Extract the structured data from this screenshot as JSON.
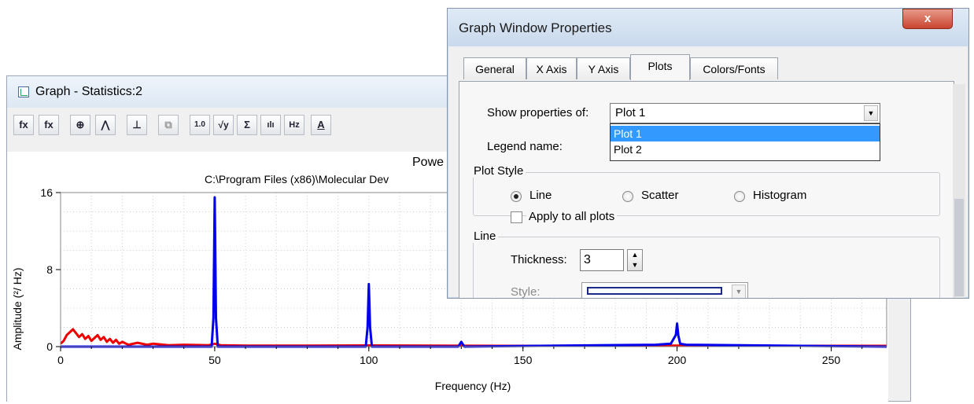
{
  "graph_window": {
    "title": "Graph - Statistics:2",
    "toolbar": [
      {
        "icon": "fx-icon",
        "label": "fx"
      },
      {
        "icon": "formula-sheet-icon",
        "label": "fx"
      },
      {
        "icon": "zoom-in-icon",
        "label": "⊕"
      },
      {
        "icon": "autoscale-icon",
        "label": "⋀"
      },
      {
        "icon": "axis-icon",
        "label": "⊥"
      },
      {
        "icon": "copy-icon",
        "label": "⧉"
      },
      {
        "icon": "scale-1-0-icon",
        "label": "1.0"
      },
      {
        "icon": "sqrt-y-icon",
        "label": "√y"
      },
      {
        "icon": "sigma-icon",
        "label": "Σ"
      },
      {
        "icon": "histogram-icon",
        "label": "ılı"
      },
      {
        "icon": "hz-icon",
        "label": "Hz"
      },
      {
        "icon": "text-icon",
        "label": "A"
      }
    ],
    "plot_title": "Powe",
    "plot_subtitle": "C:\\Program Files (x86)\\Molecular Dev"
  },
  "chart_data": {
    "type": "line",
    "title": "Powe",
    "subtitle": "C:\\Program Files (x86)\\Molecular Dev",
    "xlabel": "Frequency (Hz)",
    "ylabel": "Amplitude (²/ Hz)",
    "xlim": [
      0,
      268
    ],
    "ylim": [
      0,
      16
    ],
    "xticks": [
      "0",
      "50",
      "100",
      "150",
      "200",
      "250"
    ],
    "yticks": [
      "0",
      "8",
      "16"
    ],
    "grid": true,
    "series": [
      {
        "color": "#0000ee",
        "x": [
          0,
          49,
          49.6,
          50,
          50.4,
          51,
          99,
          99.6,
          100,
          100.4,
          101,
          129,
          130,
          131,
          193,
          198,
          199.6,
          200,
          200.4,
          201,
          203,
          268
        ],
        "y": [
          0,
          0,
          3,
          15.5,
          3,
          0,
          0,
          2,
          6.5,
          2,
          0,
          0,
          0.5,
          0,
          0.2,
          0.3,
          1.2,
          2.4,
          1.2,
          0.3,
          0.2,
          0
        ]
      },
      {
        "color": "#ee0000",
        "x": [
          0,
          1,
          2,
          3,
          4,
          5,
          6,
          7,
          8,
          9,
          10,
          11,
          12,
          13,
          14,
          15,
          16,
          17,
          18,
          19,
          20,
          22,
          25,
          28,
          30,
          35,
          40,
          48,
          50,
          52,
          60,
          80,
          100,
          120,
          150,
          180,
          200,
          220,
          250,
          268
        ],
        "y": [
          0.3,
          0.6,
          1.2,
          1.5,
          1.8,
          1.4,
          1.0,
          1.3,
          0.8,
          1.1,
          0.6,
          0.9,
          1.2,
          0.7,
          1.0,
          0.5,
          0.8,
          0.4,
          0.7,
          0.3,
          0.5,
          0.2,
          0.4,
          0.2,
          0.3,
          0.15,
          0.2,
          0.15,
          0.3,
          0.15,
          0.1,
          0.1,
          0.12,
          0.1,
          0.08,
          0.1,
          0.1,
          0.08,
          0.08,
          0.08
        ]
      }
    ]
  },
  "dialog": {
    "title": "Graph Window Properties",
    "close_label": "x",
    "tabs": [
      {
        "label": "General",
        "active": false
      },
      {
        "label": "X Axis",
        "active": false
      },
      {
        "label": "Y Axis",
        "active": false
      },
      {
        "label": "Plots",
        "active": true
      },
      {
        "label": "Colors/Fonts",
        "active": false
      }
    ],
    "show_properties_label": "Show properties of:",
    "show_properties_value": "Plot 1",
    "dropdown_options": [
      "Plot 1",
      "Plot 2"
    ],
    "legend_name_label": "Legend name:",
    "plot_style": {
      "label": "Plot Style",
      "options": [
        "Line",
        "Scatter",
        "Histogram"
      ],
      "selected": "Line",
      "apply_all_label": "Apply to all plots"
    },
    "line": {
      "label": "Line",
      "thickness_label": "Thickness:",
      "thickness_value": "3",
      "style_label": "Style:"
    }
  }
}
